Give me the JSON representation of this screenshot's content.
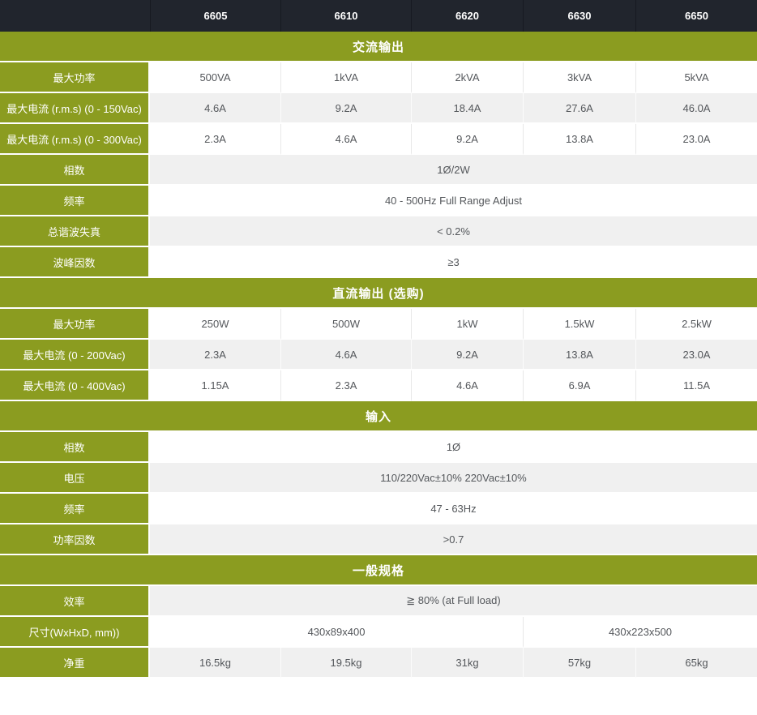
{
  "models": [
    "6605",
    "6610",
    "6620",
    "6630",
    "6650"
  ],
  "sections": [
    {
      "title": "交流输出",
      "rows": [
        {
          "label": "最大功率",
          "values": [
            "500VA",
            "1kVA",
            "2kVA",
            "3kVA",
            "5kVA"
          ]
        },
        {
          "label": "最大电流 (r.m.s) (0 - 150Vac)",
          "values": [
            "4.6A",
            "9.2A",
            "18.4A",
            "27.6A",
            "46.0A"
          ]
        },
        {
          "label": "最大电流 (r.m.s) (0 - 300Vac)",
          "values": [
            "2.3A",
            "4.6A",
            "9.2A",
            "13.8A",
            "23.0A"
          ]
        },
        {
          "label": "相数",
          "span": "1Ø/2W"
        },
        {
          "label": "频率",
          "span": "40 - 500Hz Full Range Adjust"
        },
        {
          "label": "总谐波失真",
          "span": "< 0.2%"
        },
        {
          "label": "波峰因数",
          "span": "≥3"
        }
      ]
    },
    {
      "title": "直流输出 (选购)",
      "rows": [
        {
          "label": "最大功率",
          "values": [
            "250W",
            "500W",
            "1kW",
            "1.5kW",
            "2.5kW"
          ]
        },
        {
          "label": "最大电流 (0 - 200Vac)",
          "values": [
            "2.3A",
            "4.6A",
            "9.2A",
            "13.8A",
            "23.0A"
          ]
        },
        {
          "label": "最大电流 (0 - 400Vac)",
          "values": [
            "1.15A",
            "2.3A",
            "4.6A",
            "6.9A",
            "11.5A"
          ]
        }
      ]
    },
    {
      "title": "输入",
      "rows": [
        {
          "label": "相数",
          "span": "1Ø"
        },
        {
          "label": "电压",
          "span": "110/220Vac±10% 220Vac±10%"
        },
        {
          "label": "频率",
          "span": "47 - 63Hz"
        },
        {
          "label": "功率因数",
          "span": ">0.7"
        }
      ]
    },
    {
      "title": "一般规格",
      "rows": [
        {
          "label": "效率",
          "span": "≧ 80% (at Full load)"
        },
        {
          "label": "尺寸(WxHxD, mm))",
          "cells": [
            {
              "text": "430x89x400",
              "colspan": 3
            },
            {
              "text": "430x223x500",
              "colspan": 2
            }
          ]
        },
        {
          "label": "净重",
          "values": [
            "16.5kg",
            "19.5kg",
            "31kg",
            "57kg",
            "65kg"
          ]
        }
      ]
    }
  ],
  "colors": {
    "header_bg": "#21252d",
    "accent_green": "#8b9c20",
    "stripe_gray": "#f0f0f0",
    "divider_gray": "#e8e8e8",
    "data_text": "#54575b",
    "header_text": "#ffffff"
  }
}
